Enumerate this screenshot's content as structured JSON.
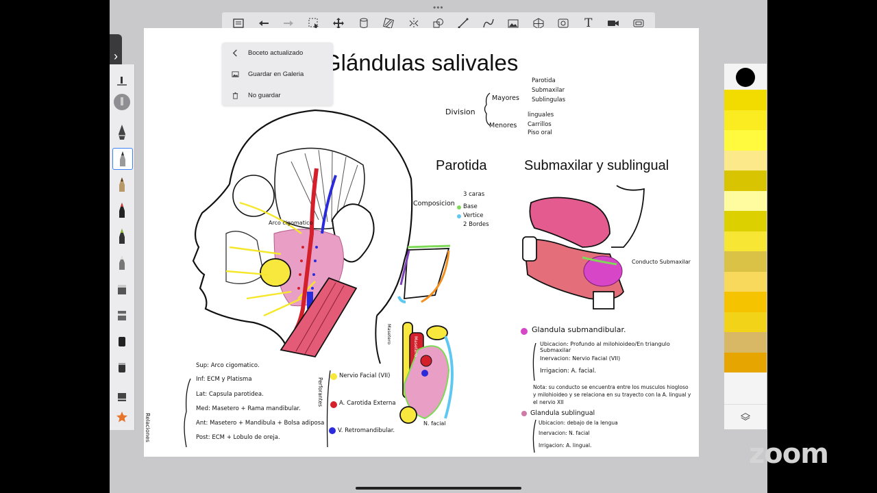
{
  "menu": {
    "back_label": "Boceto actualizado",
    "save_gallery": "Guardar en Galeria",
    "no_save": "No guardar"
  },
  "sketch": {
    "title": "Glándulas salivales",
    "division": {
      "label": "Division",
      "mayores": "Mayores",
      "mayores_items": [
        "Parotida",
        "Submaxilar",
        "Sublingulas"
      ],
      "menores": "Menores",
      "menores_items": [
        "linguales",
        "Carrillos",
        "Piso oral"
      ]
    },
    "parotida": {
      "heading": "Parotida",
      "composicion": "Composicion",
      "items": [
        "3 caras",
        "Base",
        "Vertice",
        "2 Bordes"
      ]
    },
    "submaxilar": {
      "heading": "Submaxilar y sublingual",
      "conducto": "Conducto Submaxilar"
    },
    "head_labels": {
      "arco": "Arco cigomatico"
    },
    "relaciones": {
      "side_label": "Relaciones",
      "sup": "Sup: Arco cigomatico.",
      "inf": "Inf: ECM y Platisma",
      "lat": "Lat: Capsula parotidea.",
      "med": "Med: Masetero + Rama mandibular.",
      "ant": "Ant: Masetero + Mandibula + Bolsa adiposa",
      "post": "Post: ECM + Lobulo de oreja."
    },
    "perforantes": {
      "side_label": "Perforantes",
      "items": [
        "Nervio Facial (VII)",
        "A. Carotida Externa",
        "V. Retromandibular."
      ]
    },
    "cross": {
      "masetero": "Masetero",
      "nfacial": "N. facial",
      "left_label": "Masetero"
    },
    "submandibular": {
      "heading": "Glandula submandibular.",
      "ubicacion": "Ubicacion: Profundo al milohioideo/En triangulo Submaxilar",
      "inervacion": "Inervacion: Nervio Facial (VII)",
      "irrigacion": "Irrigacion: A. facial.",
      "nota": "Nota: su conducto se encuentra entre los musculos hiogloso y milohioideo y se relaciona en su trayecto con la A. lingual y el nervio XII"
    },
    "sublingual": {
      "heading": "Glandula sublingual",
      "ubicacion": "Ubicacion: debajo de la lengua",
      "inervacion": "Inervacion: N. facial",
      "irrigacion": "Irrigacion: A. lingual."
    }
  },
  "palette": [
    "#f2dc00",
    "#fbeb21",
    "#fffa3d",
    "#fbe98a",
    "#d8c400",
    "#fffc9f",
    "#ddd000",
    "#f7e734",
    "#dac247",
    "#f8d95c",
    "#f5c300",
    "#f2d317",
    "#d8b865",
    "#e6a500"
  ],
  "logo": "zoom"
}
